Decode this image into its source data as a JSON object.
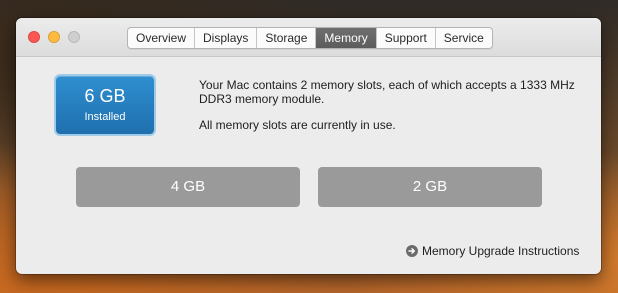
{
  "window": {
    "tabs": [
      {
        "label": "Overview",
        "active": false
      },
      {
        "label": "Displays",
        "active": false
      },
      {
        "label": "Storage",
        "active": false
      },
      {
        "label": "Memory",
        "active": true
      },
      {
        "label": "Support",
        "active": false
      },
      {
        "label": "Service",
        "active": false
      }
    ]
  },
  "memory": {
    "installed_amount": "6 GB",
    "installed_label": "Installed",
    "description_line1": "Your Mac contains 2 memory slots, each of which accepts a 1333 MHz DDR3 memory module.",
    "description_line2": "All memory slots are currently in use.",
    "slots": [
      {
        "label": "4 GB"
      },
      {
        "label": "2 GB"
      }
    ],
    "upgrade_link": "Memory Upgrade Instructions"
  },
  "colors": {
    "active_tab": "#5c5c5c",
    "installed_badge": "#1f6fae",
    "slot_fill": "#9a9a9a",
    "close_button": "#fc5753",
    "minimize_button": "#fdbc40",
    "zoom_button": "#cfcfcf"
  },
  "icons": {
    "upgrade_link_icon": "arrow-circle-right-icon"
  }
}
